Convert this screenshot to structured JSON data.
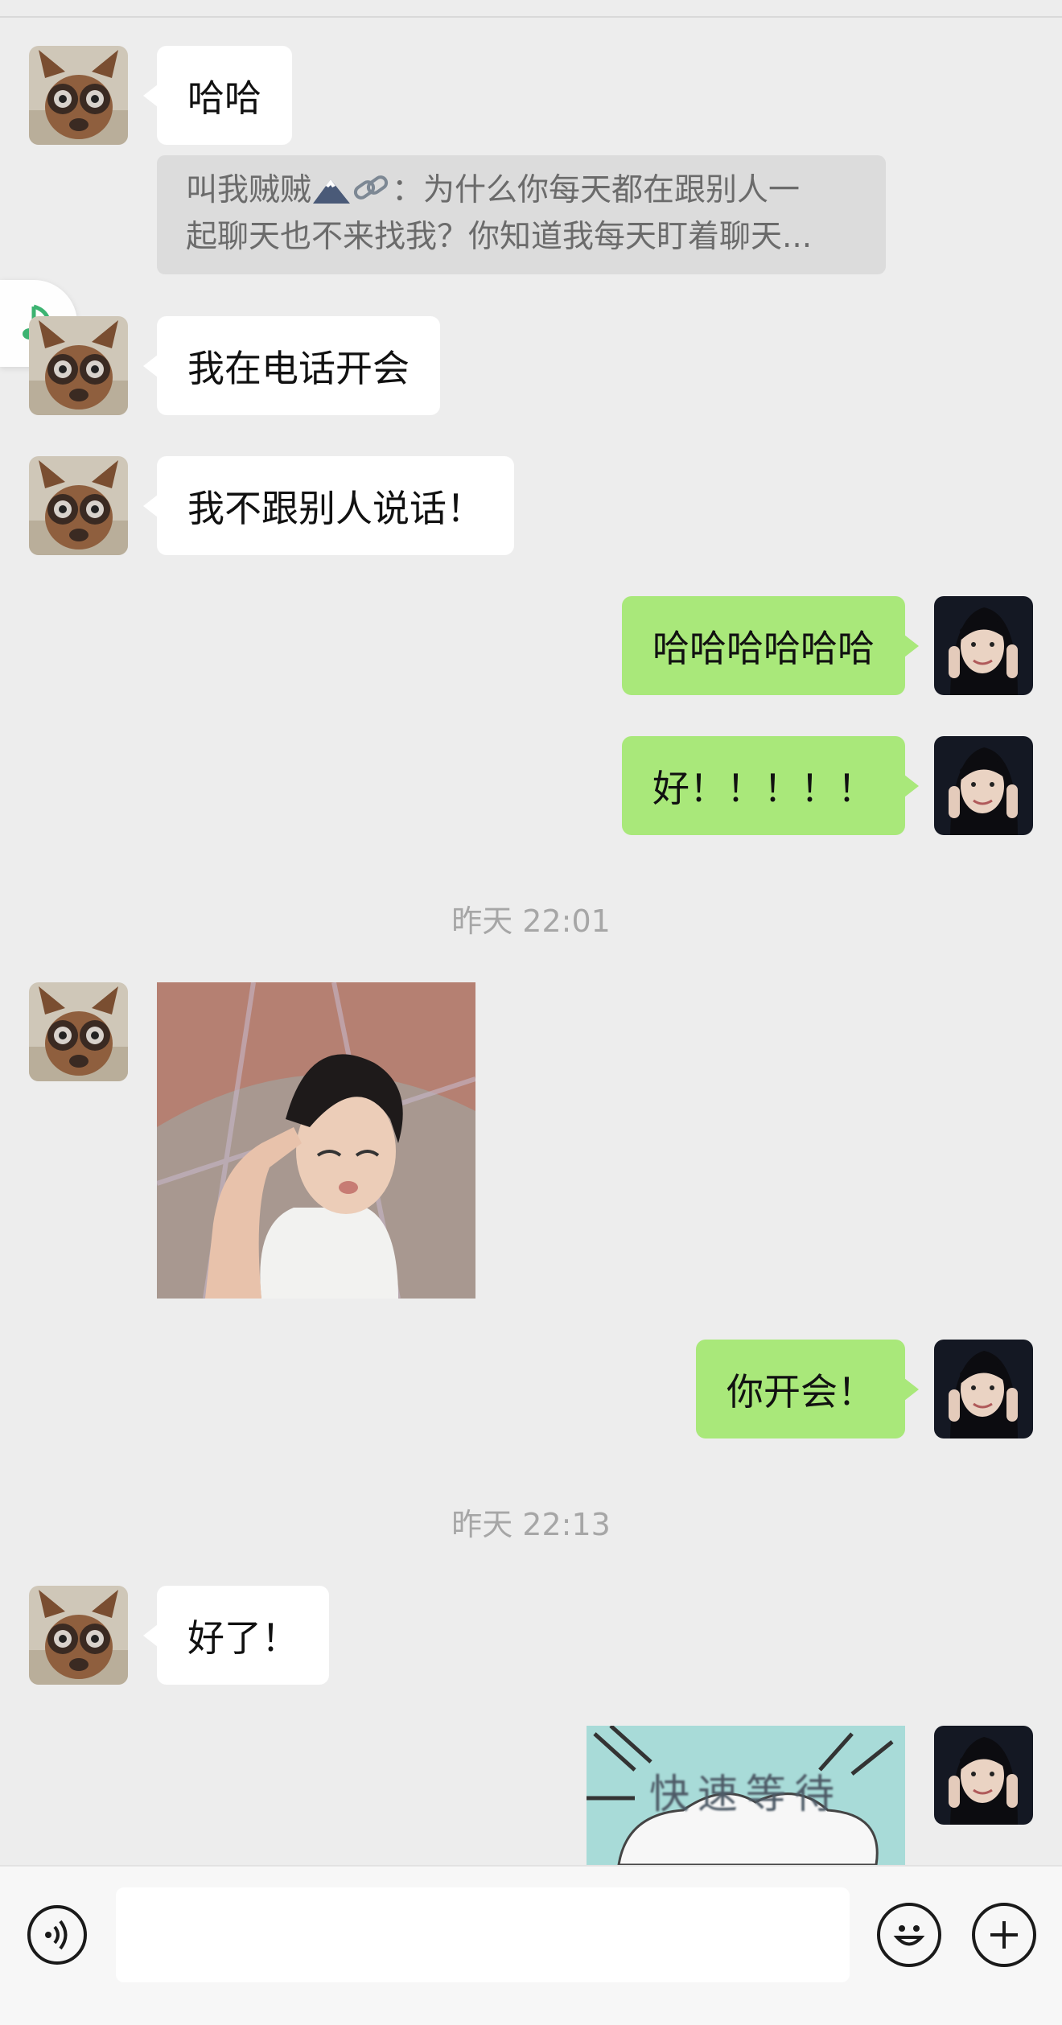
{
  "messages": {
    "m1_text": "哈哈",
    "quote_sender": "叫我贼贼",
    "quote_line1_rest": "：为什么你每天都在跟别人一",
    "quote_line2": "起聊天也不来找我？你知道我每天盯着聊天...",
    "m2_text": "我在电话开会",
    "m3_text": "我不跟别人说话！",
    "m4_text": "哈哈哈哈哈哈",
    "m5_text": "好！！！！！",
    "time1": "昨天 22:01",
    "m7_text": "你开会！",
    "time2": "昨天 22:13",
    "m8_text": "好了！",
    "sticker_text": "快速等待"
  },
  "icons": {
    "voice": "voice-input-icon",
    "emoji": "emoji-icon",
    "plus": "plus-icon",
    "music": "music-note-icon"
  },
  "colors": {
    "background": "#ededed",
    "incoming_bubble": "#ffffff",
    "outgoing_bubble": "#a9e87a",
    "timestamp_text": "#a6a6a6",
    "accent_green": "#3cb371"
  }
}
